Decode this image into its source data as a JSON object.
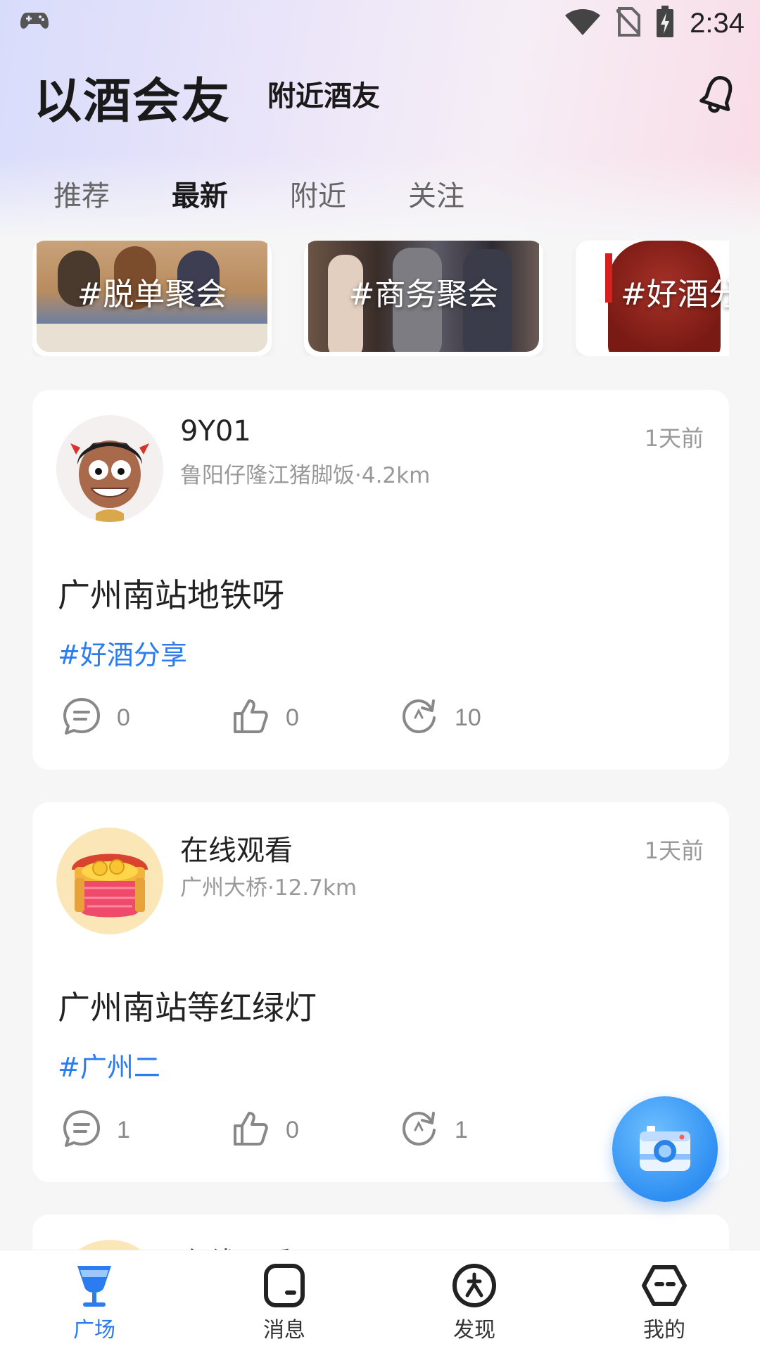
{
  "status_bar": {
    "time": "2:34"
  },
  "header": {
    "title": "以酒会友",
    "subtitle": "附近酒友",
    "bell_icon": "bell-icon"
  },
  "tabs": [
    {
      "label": "推荐",
      "active": false
    },
    {
      "label": "最新",
      "active": true
    },
    {
      "label": "附近",
      "active": false
    },
    {
      "label": "关注",
      "active": false
    }
  ],
  "topics": [
    {
      "label": "#脱单聚会"
    },
    {
      "label": "#商务聚会"
    },
    {
      "label": "#好酒分享"
    }
  ],
  "posts": [
    {
      "username": "9Y01",
      "location": "鲁阳仔隆江猪脚饭·4.2km",
      "time": "1天前",
      "text": "广州南站地铁呀",
      "tag": "#好酒分享",
      "comments": "0",
      "likes": "0",
      "shares": "10"
    },
    {
      "username": "在线观看",
      "location": "广州大桥·12.7km",
      "time": "1天前",
      "text": "广州南站等红绿灯",
      "tag": "#广州二",
      "comments": "1",
      "likes": "0",
      "shares": "1"
    },
    {
      "username": "在线观看"
    }
  ],
  "fab": {
    "icon": "camera-icon"
  },
  "bottom_nav": [
    {
      "label": "广场",
      "icon": "cocktail-glass-icon",
      "active": true
    },
    {
      "label": "消息",
      "icon": "message-icon",
      "active": false
    },
    {
      "label": "发现",
      "icon": "compass-icon",
      "active": false
    },
    {
      "label": "我的",
      "icon": "profile-icon",
      "active": false
    }
  ],
  "colors": {
    "accent": "#2a7cf0",
    "tag": "#2a7cf0",
    "muted": "#999999"
  }
}
